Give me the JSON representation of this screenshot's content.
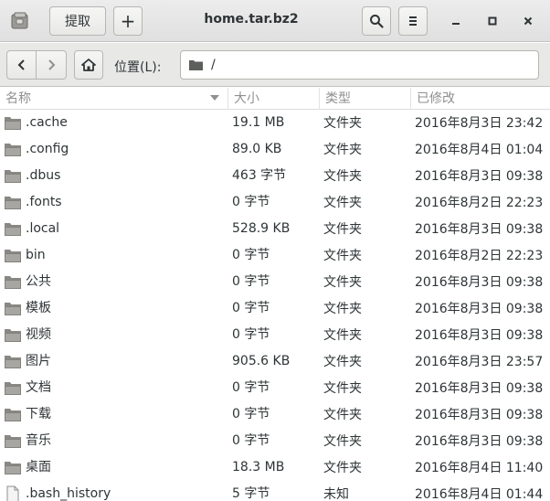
{
  "header": {
    "title": "home.tar.bz2",
    "extract_label": "提取",
    "add_label": "+",
    "app_icon": "archive-manager-icon",
    "search_icon": "search-icon",
    "menu_icon": "hamburger-menu-icon"
  },
  "window_controls": {
    "minimize": "minimize-icon",
    "maximize": "maximize-icon",
    "close": "close-icon"
  },
  "location": {
    "label": "位置(L):",
    "path": "/",
    "back_icon": "chevron-left-icon",
    "forward_icon": "chevron-right-icon",
    "home_icon": "home-icon"
  },
  "columns": {
    "name": "名称",
    "size": "大小",
    "type": "类型",
    "modified": "已修改"
  },
  "files": [
    {
      "name": ".cache",
      "size": "19.1 MB",
      "type": "文件夹",
      "modified": "2016年8月3日 23:42",
      "icon": "folder-icon"
    },
    {
      "name": ".config",
      "size": "89.0 KB",
      "type": "文件夹",
      "modified": "2016年8月4日 01:04",
      "icon": "folder-icon"
    },
    {
      "name": ".dbus",
      "size": "463 字节",
      "type": "文件夹",
      "modified": "2016年8月3日 09:38",
      "icon": "folder-icon"
    },
    {
      "name": ".fonts",
      "size": "0 字节",
      "type": "文件夹",
      "modified": "2016年8月2日 22:23",
      "icon": "folder-icon"
    },
    {
      "name": ".local",
      "size": "528.9 KB",
      "type": "文件夹",
      "modified": "2016年8月3日 09:38",
      "icon": "folder-icon"
    },
    {
      "name": "bin",
      "size": "0 字节",
      "type": "文件夹",
      "modified": "2016年8月2日 22:23",
      "icon": "folder-icon"
    },
    {
      "name": "公共",
      "size": "0 字节",
      "type": "文件夹",
      "modified": "2016年8月3日 09:38",
      "icon": "folder-icon"
    },
    {
      "name": "模板",
      "size": "0 字节",
      "type": "文件夹",
      "modified": "2016年8月3日 09:38",
      "icon": "folder-icon"
    },
    {
      "name": "视频",
      "size": "0 字节",
      "type": "文件夹",
      "modified": "2016年8月3日 09:38",
      "icon": "folder-icon"
    },
    {
      "name": "图片",
      "size": "905.6 KB",
      "type": "文件夹",
      "modified": "2016年8月3日 23:57",
      "icon": "folder-icon"
    },
    {
      "name": "文档",
      "size": "0 字节",
      "type": "文件夹",
      "modified": "2016年8月3日 09:38",
      "icon": "folder-icon"
    },
    {
      "name": "下载",
      "size": "0 字节",
      "type": "文件夹",
      "modified": "2016年8月3日 09:38",
      "icon": "folder-icon"
    },
    {
      "name": "音乐",
      "size": "0 字节",
      "type": "文件夹",
      "modified": "2016年8月3日 09:38",
      "icon": "folder-icon"
    },
    {
      "name": "桌面",
      "size": "18.3 MB",
      "type": "文件夹",
      "modified": "2016年8月4日 11:40",
      "icon": "folder-icon"
    },
    {
      "name": ".bash_history",
      "size": "5 字节",
      "type": "未知",
      "modified": "2016年8月4日 01:44",
      "icon": "file-icon"
    }
  ],
  "colors": {
    "folder": "#a8a6a2",
    "folder_dark": "#8a8884",
    "header_text": "#8e918f",
    "text": "#2e3436"
  }
}
